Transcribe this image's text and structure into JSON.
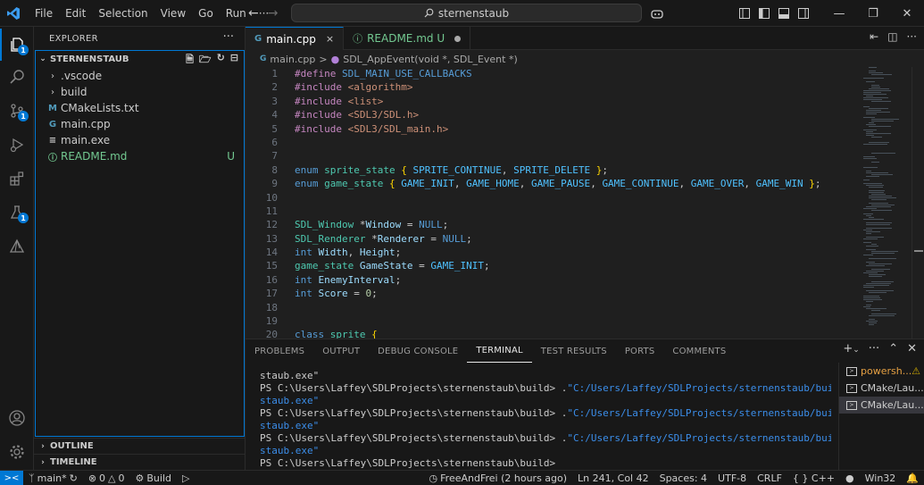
{
  "titlebar": {
    "menu": [
      "File",
      "Edit",
      "Selection",
      "View",
      "Go",
      "Run",
      "···"
    ],
    "search": "sternenstaub"
  },
  "activity": {
    "badges": {
      "explorer": "1",
      "scm": "1",
      "testing": "1"
    }
  },
  "sidebar": {
    "title": "EXPLORER",
    "more": "···",
    "folder": "STERNENSTAUB",
    "items": [
      {
        "label": ".vscode",
        "kind": "folder"
      },
      {
        "label": "build",
        "kind": "folder"
      },
      {
        "label": "CMakeLists.txt",
        "kind": "cmake",
        "icon": "M"
      },
      {
        "label": "main.cpp",
        "kind": "cpp",
        "icon": "G"
      },
      {
        "label": "main.exe",
        "kind": "exe",
        "icon": "≡"
      },
      {
        "label": "README.md",
        "kind": "md",
        "icon": "ⓘ",
        "status": "U"
      }
    ],
    "outline": "OUTLINE",
    "timeline": "TIMELINE"
  },
  "editor": {
    "tabs": [
      {
        "label": "main.cpp",
        "icon": "G",
        "close": "×"
      },
      {
        "label": "README.md U",
        "icon": "ⓘ"
      }
    ],
    "breadcrumb": {
      "file": "main.cpp",
      "sep": ">",
      "symbol": "SDL_AppEvent(void *, SDL_Event *)"
    },
    "lines": [
      {
        "n": "1"
      },
      {
        "n": "2"
      },
      {
        "n": "3"
      },
      {
        "n": "4"
      },
      {
        "n": "5"
      },
      {
        "n": "6"
      },
      {
        "n": "7"
      },
      {
        "n": "8"
      },
      {
        "n": "9"
      },
      {
        "n": "10"
      },
      {
        "n": "11"
      },
      {
        "n": "12"
      },
      {
        "n": "13"
      },
      {
        "n": "14"
      },
      {
        "n": "15"
      },
      {
        "n": "16"
      },
      {
        "n": "17"
      },
      {
        "n": "18"
      },
      {
        "n": "19"
      },
      {
        "n": "20"
      }
    ],
    "code": {
      "l1": [
        "#define",
        " ",
        "SDL_MAIN_USE_CALLBACKS"
      ],
      "l2": [
        "#include",
        " ",
        "<algorithm>"
      ],
      "l3": [
        "#include",
        " ",
        "<list>"
      ],
      "l4": [
        "#include",
        " ",
        "<SDL3/SDL.h>"
      ],
      "l5": [
        "#include",
        " ",
        "<SDL3/SDL_main.h>"
      ],
      "l8": [
        "enum",
        " ",
        "sprite_state",
        " ",
        "{",
        " ",
        "SPRITE_CONTINUE",
        ", ",
        "SPRITE_DELETE",
        " ",
        "}",
        ";"
      ],
      "l9": [
        "enum",
        " ",
        "game_state",
        " ",
        "{",
        " ",
        "GAME_INIT",
        ", ",
        "GAME_HOME",
        ", ",
        "GAME_PAUSE",
        ", ",
        "GAME_CONTINUE",
        ", ",
        "GAME_OVER",
        ", ",
        "GAME_WIN",
        " ",
        "}",
        ";"
      ],
      "l12": [
        "SDL_Window",
        " *",
        "Window",
        " = ",
        "NULL",
        ";"
      ],
      "l13": [
        "SDL_Renderer",
        " *",
        "Renderer",
        " = ",
        "NULL",
        ";"
      ],
      "l14": [
        "int",
        " ",
        "Width",
        ", ",
        "Height",
        ";"
      ],
      "l15": [
        "game_state",
        " ",
        "GameState",
        " = ",
        "GAME_INIT",
        ";"
      ],
      "l16": [
        "int",
        " ",
        "EnemyInterval",
        ";"
      ],
      "l17": [
        "int",
        " ",
        "Score",
        " = ",
        "0",
        ";"
      ],
      "l20": [
        "class",
        " ",
        "sprite",
        " ",
        "{"
      ]
    }
  },
  "panel": {
    "tabs": [
      "PROBLEMS",
      "OUTPUT",
      "DEBUG CONSOLE",
      "TERMINAL",
      "TEST RESULTS",
      "PORTS",
      "COMMENTS"
    ],
    "active_tab": "TERMINAL",
    "terminal": {
      "wrap": "staub.exe\"",
      "prompt": "PS C:\\Users\\Laffey\\SDLProjects\\sternenstaub\\build> ",
      "cmd_prefix": ".",
      "cmd_path": "\"C:/Users/Laffey/SDLProjects/sternenstaub/build/sternen"
    },
    "sessions": [
      {
        "label": "powersh...",
        "warn": "⚠"
      },
      {
        "label": "CMake/Lau..."
      },
      {
        "label": "CMake/Lau..."
      }
    ]
  },
  "statusbar": {
    "branch": "main*",
    "errors": "0",
    "warnings": "0",
    "build": "Build",
    "blame": "FreeAndFrei (2 hours ago)",
    "position": "Ln 241, Col 42",
    "spaces": "Spaces: 4",
    "encoding": "UTF-8",
    "eol": "CRLF",
    "language": "{ } C++",
    "platform": "Win32"
  },
  "colors": {
    "accent": "#0078d4",
    "keyword": "#569cd6",
    "preprocessor": "#c586c0",
    "string": "#ce9178",
    "type": "#4ec9b0",
    "enum_member": "#4fc1ff",
    "variable": "#9cdcfe",
    "number": "#b5cea8",
    "untracked": "#73c991"
  }
}
